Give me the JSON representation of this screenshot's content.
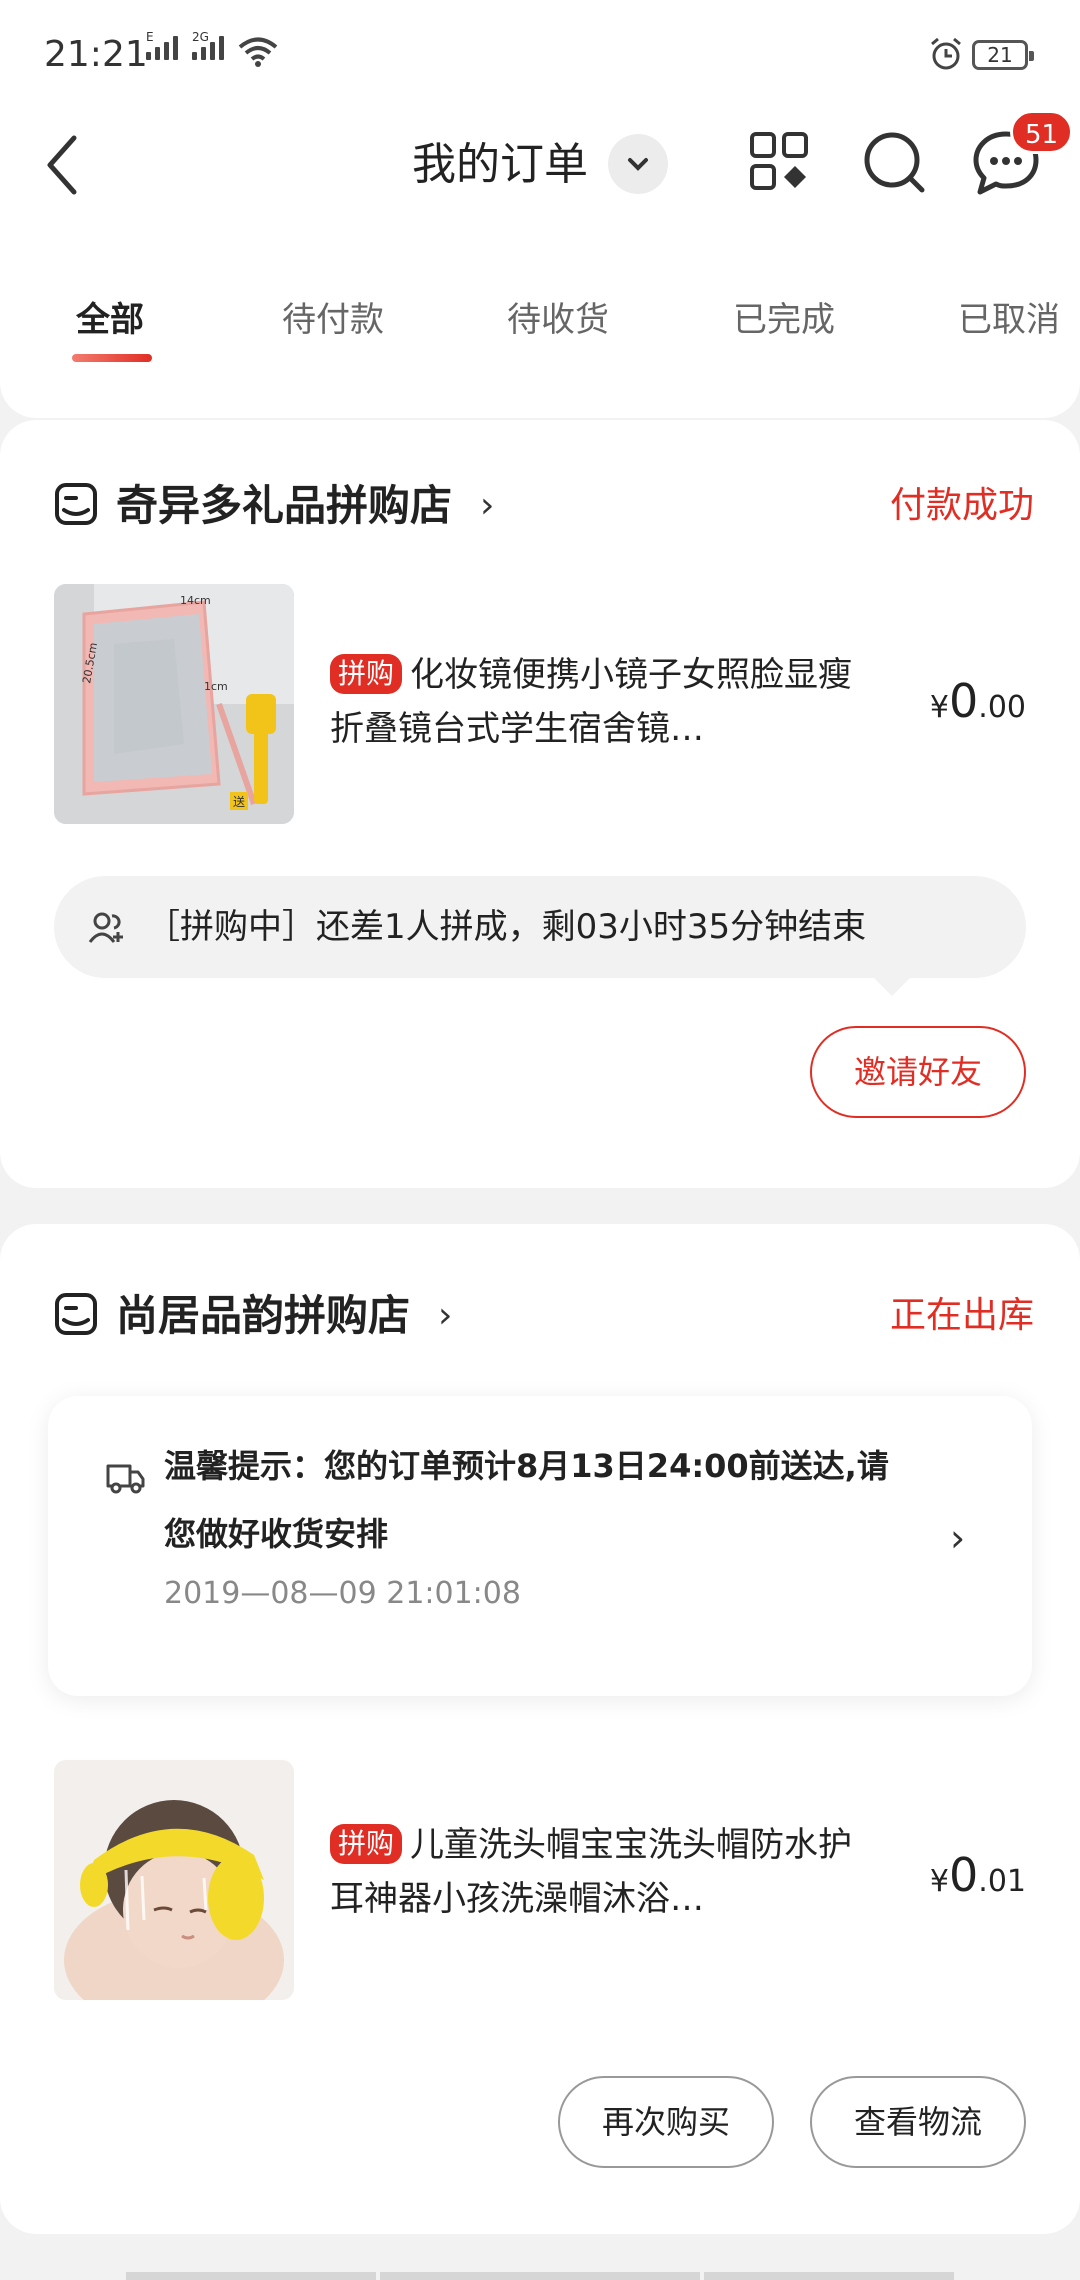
{
  "status_bar": {
    "time": "21:21",
    "net1": "E",
    "net2": "2G",
    "battery": "21"
  },
  "header": {
    "title": "我的订单",
    "message_badge": "51"
  },
  "tabs": [
    {
      "label": "全部",
      "active": true
    },
    {
      "label": "待付款",
      "active": false
    },
    {
      "label": "待收货",
      "active": false
    },
    {
      "label": "已完成",
      "active": false
    },
    {
      "label": "已取消",
      "active": false
    }
  ],
  "orders": [
    {
      "shop_name": "奇异多礼品拼购店",
      "status": "付款成功",
      "product": {
        "tag": "拼购",
        "title": "化妆镜便携小镜子女照脸显瘦折叠镜台式学生宿舍镜…",
        "currency": "¥",
        "price_int": "0",
        "price_dec": ".00",
        "image_labels": [
          "14cm",
          "20.5cm",
          "1cm",
          "送"
        ]
      },
      "group_status": "［拼购中］还差1人拼成，剩03小时35分钟结束",
      "action": "邀请好友"
    },
    {
      "shop_name": "尚居品韵拼购店",
      "status": "正在出库",
      "notice": {
        "text": "温馨提示：您的订单预计8月13日24:00前送达,请您做好收货安排",
        "time": "2019—08—09 21:01:08"
      },
      "product": {
        "tag": "拼购",
        "title": "儿童洗头帽宝宝洗头帽防水护耳神器小孩洗澡帽沐浴…",
        "currency": "¥",
        "price_int": "0",
        "price_dec": ".01"
      },
      "actions": [
        "再次购买",
        "查看物流"
      ]
    }
  ],
  "colors": {
    "accent": "#e02e24",
    "background": "#f2f2f2",
    "card": "#ffffff"
  }
}
